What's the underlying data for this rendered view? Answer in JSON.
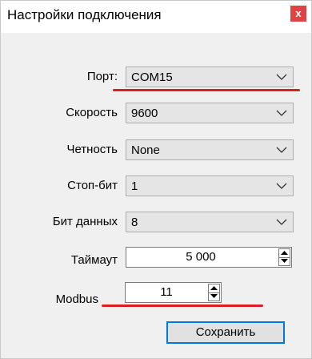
{
  "window": {
    "title": "Настройки подключения",
    "close_glyph": "x"
  },
  "fields": {
    "port": {
      "label": "Порт:",
      "value": "COM15"
    },
    "speed": {
      "label": "Скорость",
      "value": "9600"
    },
    "parity": {
      "label": "Четность",
      "value": "None"
    },
    "stop_bits": {
      "label": "Стоп-бит",
      "value": "1"
    },
    "data_bits": {
      "label": "Бит данных",
      "value": "8"
    },
    "timeout": {
      "label": "Таймаут",
      "value": "5 000"
    },
    "modbus": {
      "label": "Modbus",
      "value": "11"
    }
  },
  "buttons": {
    "save_label": "Сохранить"
  },
  "colors": {
    "annotation_underline": "#d92020",
    "close_button": "#e04343",
    "focus_border": "#0078d7"
  }
}
